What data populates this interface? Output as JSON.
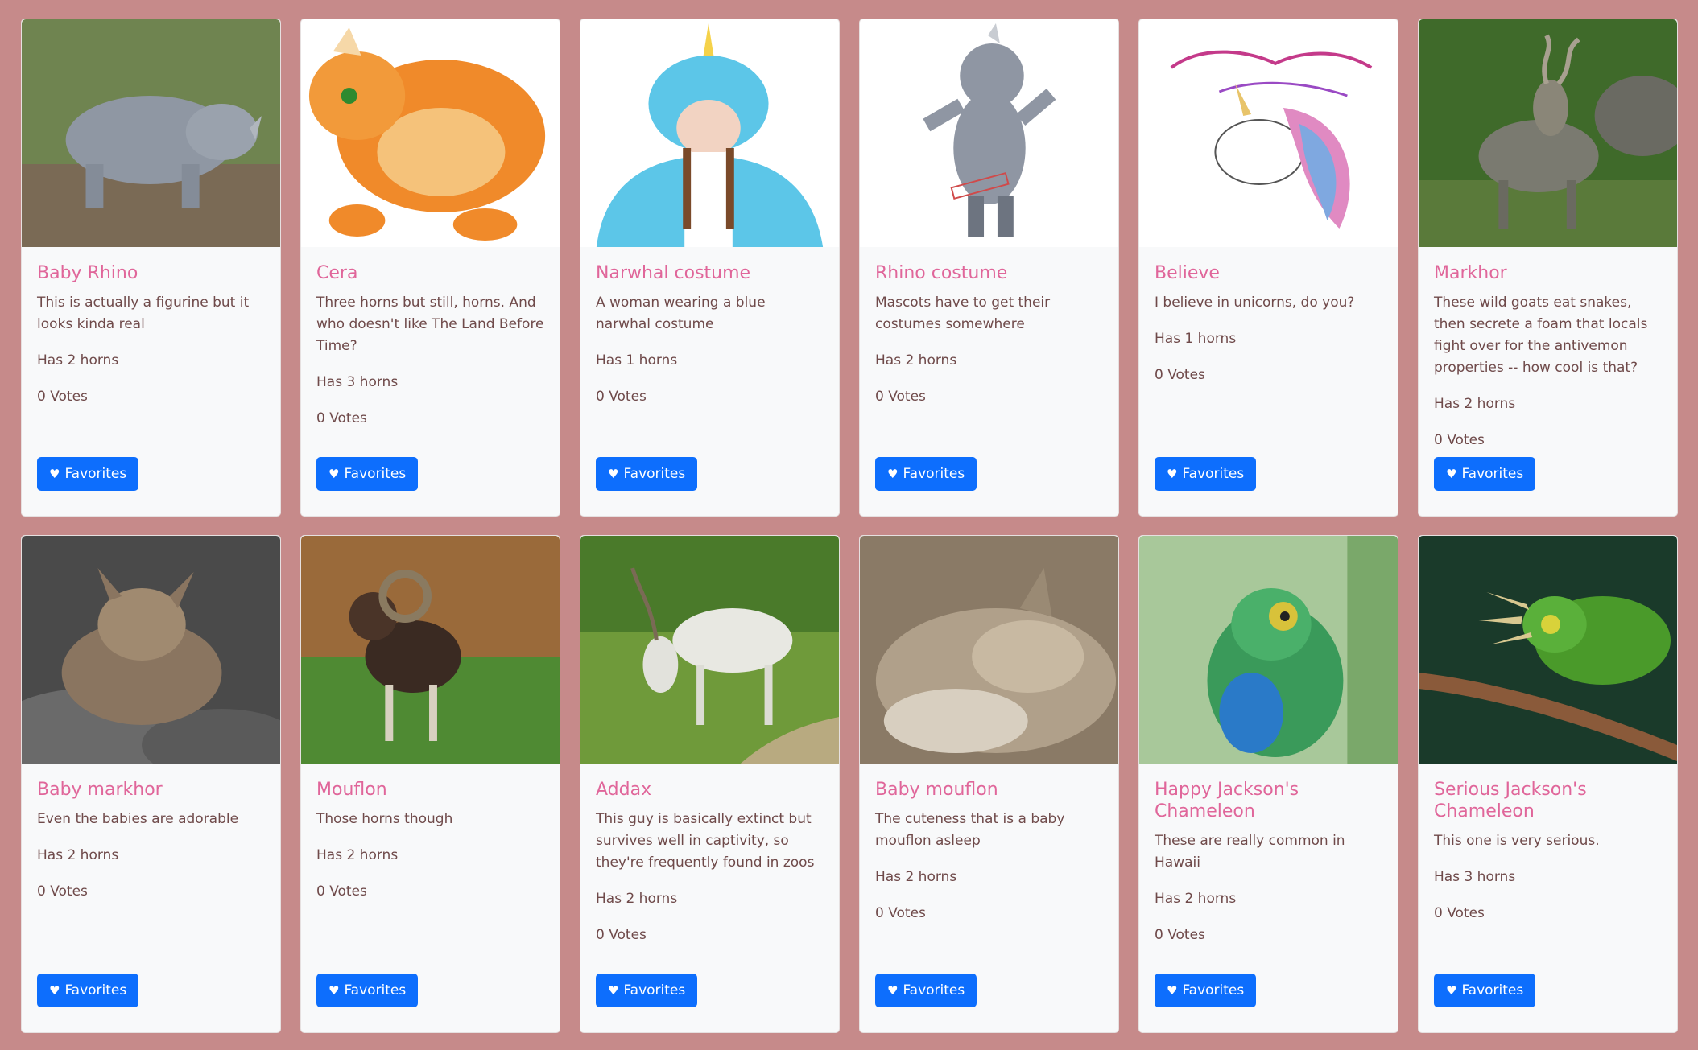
{
  "cards": [
    {
      "title": "Baby Rhino",
      "description": "This is actually a figurine but it looks kinda real",
      "horns": "Has 2 horns",
      "votes": "0 Votes",
      "button": "Favorites",
      "icon": "heart-icon",
      "image_colors": [
        "#7e8c6a",
        "#8f97a3",
        "#5a6b3a"
      ]
    },
    {
      "title": "Cera",
      "description": "Three horns but still, horns. And who doesn't like The Land Before Time?",
      "horns": "Has 3 horns",
      "votes": "0 Votes",
      "button": "Favorites",
      "icon": "heart-icon",
      "image_colors": [
        "#ffffff",
        "#f08a2a",
        "#f5c27a"
      ]
    },
    {
      "title": "Narwhal costume",
      "description": "A woman wearing a blue narwhal costume",
      "horns": "Has 1 horns",
      "votes": "0 Votes",
      "button": "Favorites",
      "icon": "heart-icon",
      "image_colors": [
        "#ffffff",
        "#5cc6e8",
        "#3aa7cf"
      ]
    },
    {
      "title": "Rhino costume",
      "description": "Mascots have to get their costumes somewhere",
      "horns": "Has 2 horns",
      "votes": "0 Votes",
      "button": "Favorites",
      "icon": "heart-icon",
      "image_colors": [
        "#ffffff",
        "#8f96a3",
        "#6d7480"
      ]
    },
    {
      "title": "Believe",
      "description": "I believe in unicorns, do you?",
      "horns": "Has 1 horns",
      "votes": "0 Votes",
      "button": "Favorites",
      "icon": "heart-icon",
      "image_colors": [
        "#ffffff",
        "#e08ac2",
        "#7fa8e0"
      ]
    },
    {
      "title": "Markhor",
      "description": "These wild goats eat snakes, then secrete a foam that locals fight over for the antivemon properties -- how cool is that?",
      "horns": "Has 2 horns",
      "votes": "0 Votes",
      "button": "Favorites",
      "icon": "heart-icon",
      "image_colors": [
        "#3f6a2a",
        "#6f8a4a",
        "#7a7a70"
      ]
    },
    {
      "title": "Baby markhor",
      "description": "Even the babies are adorable",
      "horns": "Has 2 horns",
      "votes": "0 Votes",
      "button": "Favorites",
      "icon": "heart-icon",
      "image_colors": [
        "#4a4a4a",
        "#8a7560",
        "#b09a80"
      ]
    },
    {
      "title": "Mouflon",
      "description": "Those horns though",
      "horns": "Has 2 horns",
      "votes": "0 Votes",
      "button": "Favorites",
      "icon": "heart-icon",
      "image_colors": [
        "#9a6a3a",
        "#5a8a3a",
        "#3a2a22"
      ]
    },
    {
      "title": "Addax",
      "description": "This guy is basically extinct but survives well in captivity, so they're frequently found in zoos",
      "horns": "Has 2 horns",
      "votes": "0 Votes",
      "button": "Favorites",
      "icon": "heart-icon",
      "image_colors": [
        "#4a7a2a",
        "#6f9a3a",
        "#e8e8e2"
      ]
    },
    {
      "title": "Baby mouflon",
      "description": "The cuteness that is a baby mouflon asleep",
      "horns": "Has 2 horns",
      "votes": "0 Votes",
      "button": "Favorites",
      "icon": "heart-icon",
      "image_colors": [
        "#8a7a66",
        "#b0a08a",
        "#d8cfc0"
      ]
    },
    {
      "title": "Happy Jackson's Chameleon",
      "description": "These are really common in Hawaii",
      "horns": "Has 2 horns",
      "votes": "0 Votes",
      "button": "Favorites",
      "icon": "heart-icon",
      "image_colors": [
        "#a8c89a",
        "#3a9a5a",
        "#2a7ac8"
      ]
    },
    {
      "title": "Serious Jackson's Chameleon",
      "description": "This one is very serious.",
      "horns": "Has 3 horns",
      "votes": "0 Votes",
      "button": "Favorites",
      "icon": "heart-icon",
      "image_colors": [
        "#1a3a2a",
        "#4a9a2a",
        "#8a5a3a"
      ]
    }
  ],
  "colors": {
    "page_background": "#c68a8a",
    "card_background": "#f8f9fa",
    "title": "#e0669a",
    "text": "#6f4a4a",
    "button": "#0d6efd"
  }
}
